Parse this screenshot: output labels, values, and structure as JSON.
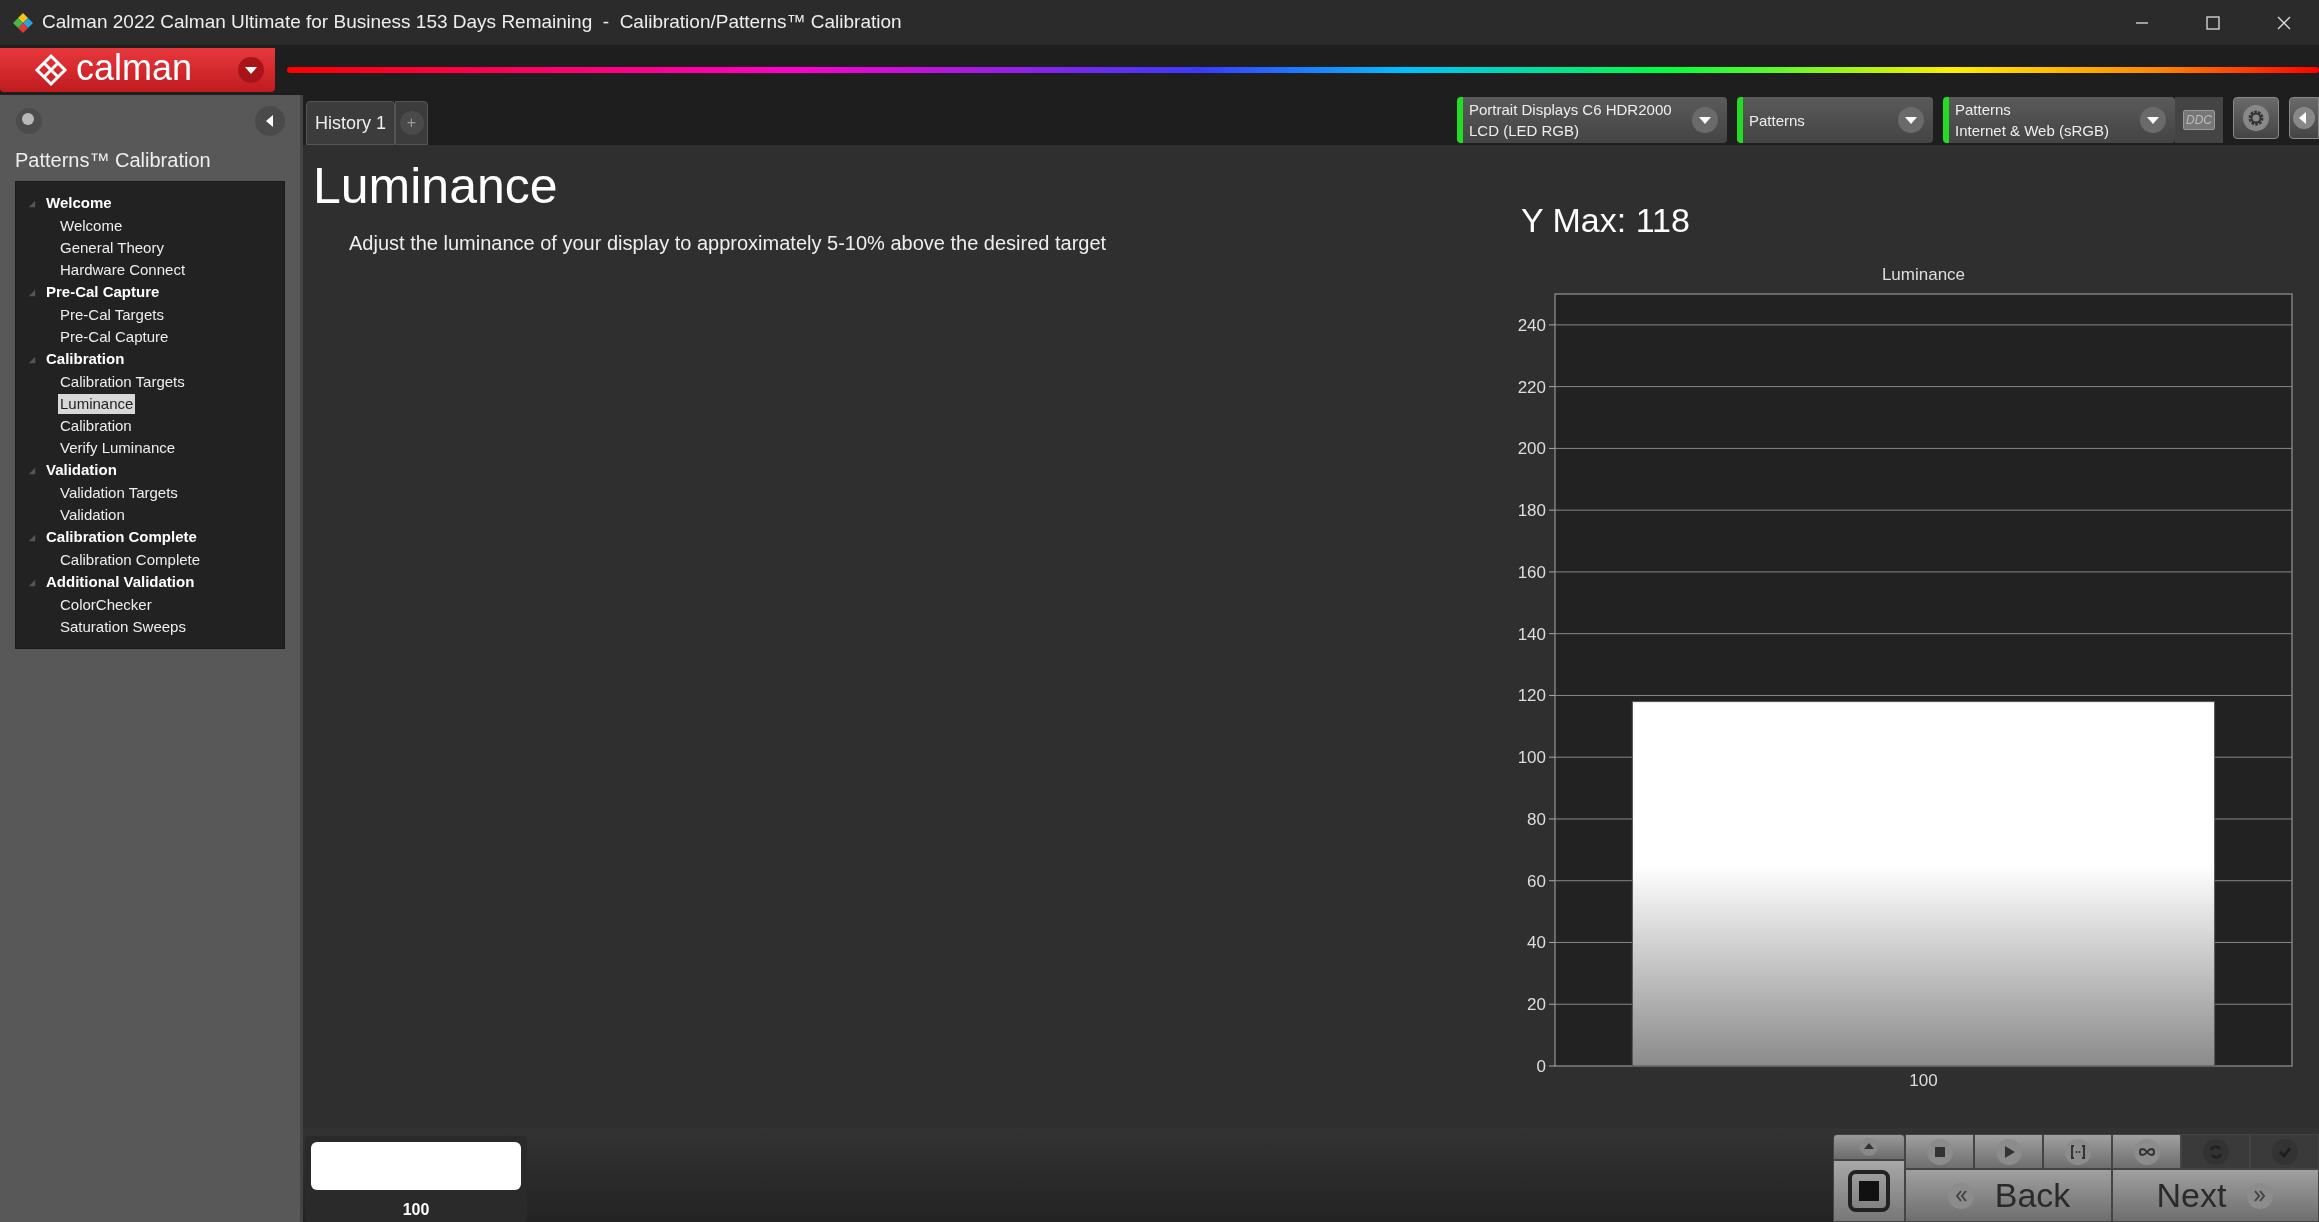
{
  "window": {
    "title": "Calman 2022 Calman Ultimate for Business 153 Days Remaining  -  Calibration/Patterns™ Calibration"
  },
  "logo": {
    "text": "calman"
  },
  "tabs": [
    {
      "label": "History 1",
      "selected": true
    }
  ],
  "add_tab": {
    "label": "+"
  },
  "source_selectors": [
    {
      "line1": "Portrait Displays C6 HDR2000",
      "line2": "LCD (LED RGB)"
    },
    {
      "line1": "Patterns"
    },
    {
      "line1": "Patterns",
      "line2": "Internet & Web (sRGB)"
    }
  ],
  "ddc_button": {
    "label": "DDC"
  },
  "sidebar": {
    "title": "Patterns™ Calibration",
    "items": [
      {
        "label": "Welcome",
        "expanded": true,
        "children": [
          {
            "label": "Welcome",
            "selected": false
          },
          {
            "label": "General Theory",
            "selected": false
          },
          {
            "label": "Hardware Connect",
            "selected": false
          }
        ]
      },
      {
        "label": "Pre-Cal Capture",
        "expanded": true,
        "children": [
          {
            "label": "Pre-Cal Targets",
            "selected": false
          },
          {
            "label": "Pre-Cal Capture",
            "selected": false
          }
        ]
      },
      {
        "label": "Calibration",
        "expanded": true,
        "children": [
          {
            "label": "Calibration Targets",
            "selected": false
          },
          {
            "label": "Luminance",
            "selected": true
          },
          {
            "label": "Calibration",
            "selected": false
          },
          {
            "label": "Verify Luminance",
            "selected": false
          }
        ]
      },
      {
        "label": "Validation",
        "expanded": true,
        "children": [
          {
            "label": "Validation Targets",
            "selected": false
          },
          {
            "label": "Validation",
            "selected": false
          }
        ]
      },
      {
        "label": "Calibration Complete",
        "expanded": true,
        "children": [
          {
            "label": "Calibration Complete",
            "selected": false
          }
        ]
      },
      {
        "label": "Additional Validation",
        "expanded": true,
        "children": [
          {
            "label": "ColorChecker",
            "selected": false
          },
          {
            "label": "Saturation Sweeps",
            "selected": false
          }
        ]
      }
    ]
  },
  "main": {
    "heading": "Luminance",
    "instruction": "Adjust the luminance of your display to approximately 5-10% above the desired target",
    "y_max": "Y Max: 118",
    "chart_data": {
      "type": "bar",
      "grid": true,
      "title": "Luminance",
      "categories": [
        "100"
      ],
      "values": [
        118
      ],
      "ylim": [
        0,
        250
      ],
      "yticks": [
        0,
        20,
        40,
        60,
        80,
        100,
        120,
        140,
        160,
        180,
        200,
        220,
        240
      ]
    }
  },
  "swatch": {
    "label": "100"
  },
  "controls": {
    "back": "Back",
    "next": "Next"
  }
}
